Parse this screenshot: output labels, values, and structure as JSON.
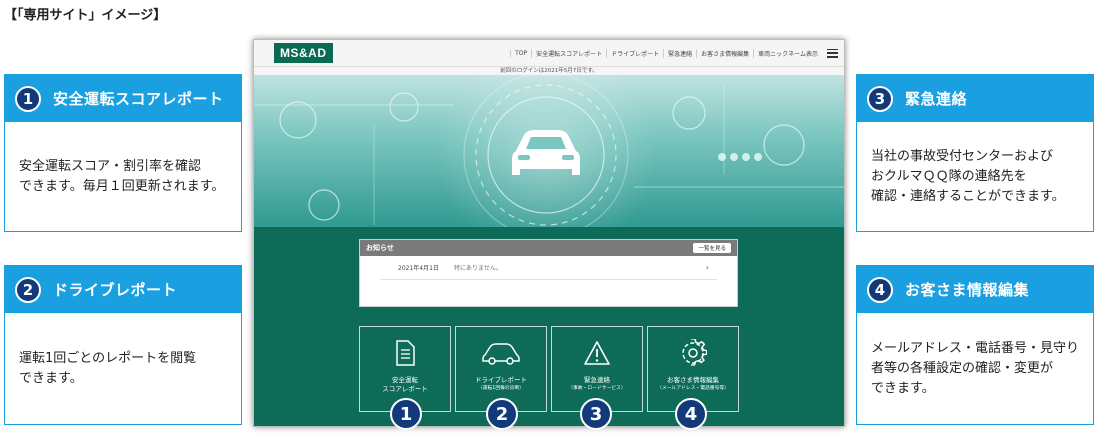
{
  "page_heading": "【「専用サイト」イメージ】",
  "callouts": [
    {
      "num": "1",
      "title": "安全運転スコアレポート",
      "lines": [
        "安全運転スコア・割引率を確認",
        "できます。毎月１回更新されます。"
      ]
    },
    {
      "num": "2",
      "title": "ドライブレポート",
      "lines": [
        "運転1回ごとのレポートを閲覧",
        "できます。"
      ]
    },
    {
      "num": "3",
      "title": "緊急連絡",
      "lines": [
        "当社の事故受付センターおよび",
        "おクルマＱＱ隊の連絡先を",
        "確認・連絡することができます。"
      ]
    },
    {
      "num": "4",
      "title": "お客さま情報編集",
      "lines": [
        "メールアドレス・電話番号・見守り",
        "者等の各種設定の確認・変更が",
        "できます。"
      ]
    }
  ],
  "site": {
    "logo": "MS&AD",
    "nav": [
      "TOP",
      "安全運転スコアレポート",
      "ドライブレポート",
      "緊急連絡",
      "お客さま情報編集",
      "車両ニックネーム表示"
    ],
    "last_login": "前回のログインは2021年5月7日です。",
    "notice": {
      "title": "お知らせ",
      "more_button": "一覧を見る",
      "date": "2021年4月1日",
      "text": "特にありません。"
    },
    "tiles": [
      {
        "label1": "安全運転",
        "label2": "スコアレポート",
        "sub": "",
        "icon": "document-icon"
      },
      {
        "label1": "ドライブレポート",
        "label2": "",
        "sub": "（運転1回毎の診断）",
        "icon": "car-icon"
      },
      {
        "label1": "緊急連絡",
        "label2": "",
        "sub": "（事故・ロードサービス）",
        "icon": "warning-icon"
      },
      {
        "label1": "お客さま情報編集",
        "label2": "",
        "sub": "（メールアドレス・電話番号等）",
        "icon": "gear-icon"
      }
    ],
    "badges": [
      "1",
      "2",
      "3",
      "4"
    ]
  },
  "colors": {
    "callout_blue": "#1a9fe0",
    "badge_navy": "#123a7a",
    "site_green": "#0d6b57"
  }
}
